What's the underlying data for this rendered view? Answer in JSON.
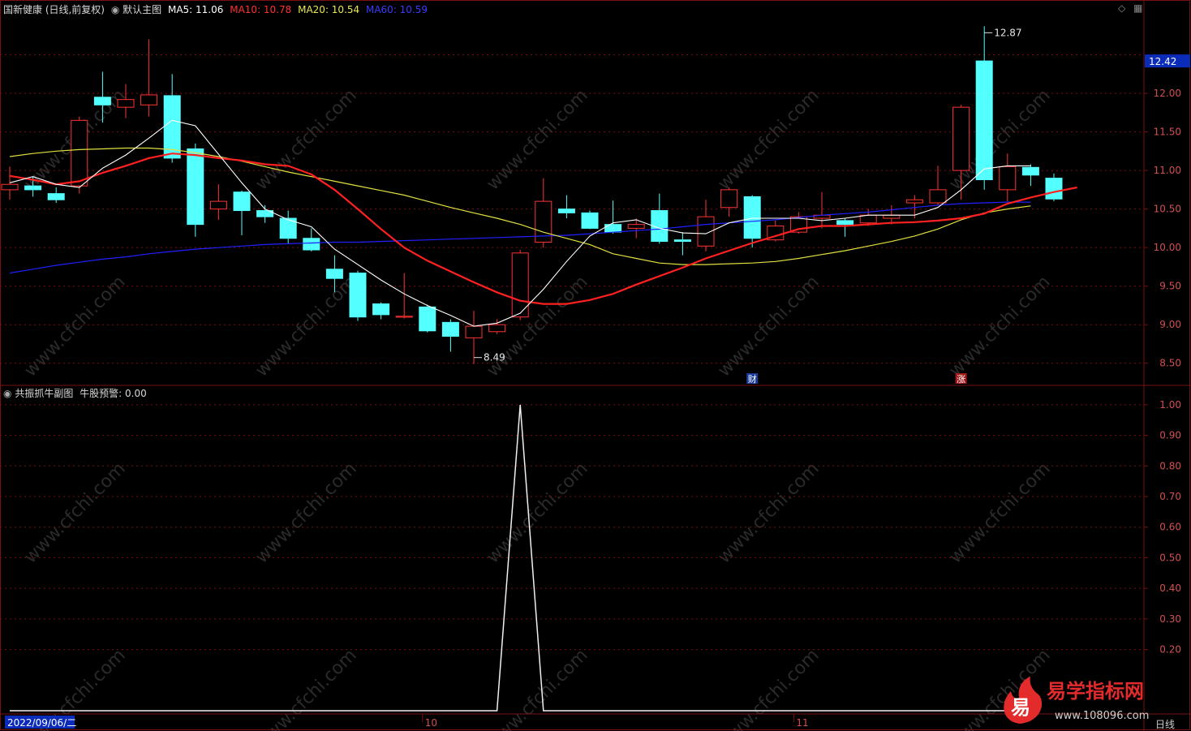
{
  "header": {
    "stock_label": "国新健康 (日线,前复权)",
    "template_label": "默认主图",
    "ma5_label": "MA5: 11.06",
    "ma10_label": "MA10: 10.78",
    "ma20_label": "MA20: 10.54",
    "ma60_label": "MA60: 10.59"
  },
  "sub_header": {
    "indicator_label": "共振抓牛副图",
    "alert_label": "牛股预警: 0.00"
  },
  "footer": {
    "cursor_date": "2022/09/06/二",
    "month_labels": [
      "10",
      "11"
    ],
    "period_label": "日线"
  },
  "markers": {
    "finance": "财",
    "limit_up": "涨"
  },
  "watermark": "www.cfchi.com",
  "logo": {
    "glyph": "易",
    "name": "易学指标网",
    "url": "www.108096.com"
  },
  "colors": {
    "background": "#000000",
    "up": "#ff3232",
    "down": "#54ffff",
    "ma5": "#ffffff",
    "ma10": "#ff2020",
    "ma20": "#e0e040",
    "ma60": "#2020ff",
    "grid": "#7a1010",
    "axis_text": "#d05050"
  },
  "chart_data": [
    {
      "type": "candlestick",
      "title": "国新健康 (日线,前复权)",
      "x": [
        "1",
        "2",
        "3",
        "4",
        "5",
        "6",
        "7",
        "8",
        "9",
        "10",
        "11",
        "12",
        "13",
        "14",
        "15",
        "16",
        "17",
        "18",
        "19",
        "20",
        "21",
        "22",
        "23",
        "24",
        "25",
        "26",
        "27",
        "28",
        "29",
        "30",
        "31",
        "32",
        "33",
        "34",
        "35",
        "36",
        "37",
        "38",
        "39",
        "40",
        "41",
        "42",
        "43",
        "44",
        "45"
      ],
      "candles": [
        {
          "o": 10.75,
          "c": 10.82,
          "h": 11.05,
          "l": 10.62
        },
        {
          "o": 10.8,
          "c": 10.75,
          "h": 10.92,
          "l": 10.66
        },
        {
          "o": 10.7,
          "c": 10.62,
          "h": 10.78,
          "l": 10.58
        },
        {
          "o": 10.8,
          "c": 11.65,
          "h": 11.7,
          "l": 10.7
        },
        {
          "o": 11.95,
          "c": 11.85,
          "h": 12.28,
          "l": 11.62
        },
        {
          "o": 11.82,
          "c": 11.92,
          "h": 12.12,
          "l": 11.68
        },
        {
          "o": 11.85,
          "c": 11.98,
          "h": 12.7,
          "l": 11.7
        },
        {
          "o": 11.97,
          "c": 11.16,
          "h": 12.25,
          "l": 11.1
        },
        {
          "o": 11.28,
          "c": 10.3,
          "h": 11.35,
          "l": 10.14
        },
        {
          "o": 10.5,
          "c": 10.6,
          "h": 10.82,
          "l": 10.36
        },
        {
          "o": 10.72,
          "c": 10.48,
          "h": 10.74,
          "l": 10.16
        },
        {
          "o": 10.48,
          "c": 10.4,
          "h": 10.55,
          "l": 10.32
        },
        {
          "o": 10.38,
          "c": 10.12,
          "h": 10.48,
          "l": 10.05
        },
        {
          "o": 10.12,
          "c": 9.97,
          "h": 10.25,
          "l": 9.95
        },
        {
          "o": 9.72,
          "c": 9.6,
          "h": 9.9,
          "l": 9.42
        },
        {
          "o": 9.67,
          "c": 9.1,
          "h": 9.7,
          "l": 9.05
        },
        {
          "o": 9.27,
          "c": 9.13,
          "h": 9.29,
          "l": 9.07
        },
        {
          "o": 9.1,
          "c": 9.11,
          "h": 9.67,
          "l": 9.08
        },
        {
          "o": 9.23,
          "c": 8.92,
          "h": 9.26,
          "l": 8.9
        },
        {
          "o": 9.03,
          "c": 8.85,
          "h": 9.07,
          "l": 8.65
        },
        {
          "o": 8.83,
          "c": 8.98,
          "h": 9.18,
          "l": 8.49
        },
        {
          "o": 8.91,
          "c": 9.0,
          "h": 9.07,
          "l": 8.88
        },
        {
          "o": 9.1,
          "c": 9.93,
          "h": 9.97,
          "l": 9.06
        },
        {
          "o": 10.07,
          "c": 10.6,
          "h": 10.9,
          "l": 10.0
        },
        {
          "o": 10.5,
          "c": 10.45,
          "h": 10.68,
          "l": 10.38
        },
        {
          "o": 10.45,
          "c": 10.25,
          "h": 10.48,
          "l": 10.24
        },
        {
          "o": 10.3,
          "c": 10.2,
          "h": 10.61,
          "l": 10.18
        },
        {
          "o": 10.25,
          "c": 10.3,
          "h": 10.38,
          "l": 10.12
        },
        {
          "o": 10.48,
          "c": 10.08,
          "h": 10.7,
          "l": 10.05
        },
        {
          "o": 10.1,
          "c": 10.08,
          "h": 10.2,
          "l": 9.9
        },
        {
          "o": 10.02,
          "c": 10.4,
          "h": 10.62,
          "l": 9.95
        },
        {
          "o": 10.52,
          "c": 10.75,
          "h": 10.78,
          "l": 10.4
        },
        {
          "o": 10.66,
          "c": 10.12,
          "h": 10.68,
          "l": 10.0
        },
        {
          "o": 10.1,
          "c": 10.28,
          "h": 10.35,
          "l": 10.08
        },
        {
          "o": 10.2,
          "c": 10.4,
          "h": 10.46,
          "l": 10.18
        },
        {
          "o": 10.38,
          "c": 10.42,
          "h": 10.72,
          "l": 10.25
        },
        {
          "o": 10.35,
          "c": 10.3,
          "h": 10.38,
          "l": 10.14
        },
        {
          "o": 10.32,
          "c": 10.42,
          "h": 10.5,
          "l": 10.28
        },
        {
          "o": 10.38,
          "c": 10.42,
          "h": 10.55,
          "l": 10.3
        },
        {
          "o": 10.58,
          "c": 10.62,
          "h": 10.68,
          "l": 10.38
        },
        {
          "o": 10.58,
          "c": 10.75,
          "h": 11.06,
          "l": 10.55
        },
        {
          "o": 11.0,
          "c": 11.82,
          "h": 11.85,
          "l": 10.62
        },
        {
          "o": 12.42,
          "c": 10.88,
          "h": 12.87,
          "l": 10.75
        },
        {
          "o": 10.75,
          "c": 11.05,
          "h": 11.22,
          "l": 10.6
        },
        {
          "o": 11.04,
          "c": 10.94,
          "h": 11.08,
          "l": 10.8
        },
        {
          "o": 10.9,
          "c": 10.63,
          "h": 10.96,
          "l": 10.6
        }
      ],
      "ma5": [
        10.84,
        10.92,
        10.82,
        10.78,
        11.03,
        11.2,
        11.42,
        11.65,
        11.58,
        11.21,
        10.84,
        10.5,
        10.36,
        10.27,
        9.98,
        9.78,
        9.58,
        9.4,
        9.25,
        9.12,
        8.98,
        9.02,
        9.15,
        9.46,
        9.82,
        10.15,
        10.32,
        10.36,
        10.25,
        10.19,
        10.18,
        10.32,
        10.38,
        10.38,
        10.38,
        10.35,
        10.38,
        10.42,
        10.42,
        10.42,
        10.52,
        10.75,
        11.02,
        11.06,
        11.06
      ],
      "ma10": [
        10.93,
        10.88,
        10.82,
        10.86,
        10.97,
        11.06,
        11.16,
        11.22,
        11.2,
        11.16,
        11.13,
        11.08,
        11.06,
        10.95,
        10.75,
        10.5,
        10.24,
        10.0,
        9.83,
        9.69,
        9.55,
        9.42,
        9.31,
        9.27,
        9.27,
        9.32,
        9.4,
        9.52,
        9.63,
        9.74,
        9.86,
        9.96,
        10.06,
        10.15,
        10.24,
        10.28,
        10.28,
        10.3,
        10.32,
        10.33,
        10.35,
        10.38,
        10.44,
        10.57,
        10.65,
        10.72,
        10.78
      ],
      "ma20": [
        11.18,
        11.22,
        11.25,
        11.27,
        11.28,
        11.29,
        11.29,
        11.27,
        11.23,
        11.18,
        11.12,
        11.05,
        10.98,
        10.92,
        10.86,
        10.8,
        10.74,
        10.68,
        10.6,
        10.52,
        10.45,
        10.38,
        10.3,
        10.2,
        10.12,
        10.04,
        9.92,
        9.86,
        9.8,
        9.78,
        9.78,
        9.79,
        9.8,
        9.82,
        9.86,
        9.91,
        9.96,
        10.02,
        10.08,
        10.15,
        10.24,
        10.36,
        10.45,
        10.5,
        10.54
      ],
      "ma60": [
        9.67,
        9.72,
        9.77,
        9.81,
        9.85,
        9.88,
        9.92,
        9.95,
        9.98,
        10.0,
        10.02,
        10.04,
        10.05,
        10.06,
        10.07,
        10.07,
        10.08,
        10.09,
        10.1,
        10.11,
        10.12,
        10.13,
        10.14,
        10.15,
        10.16,
        10.18,
        10.2,
        10.22,
        10.24,
        10.27,
        10.3,
        10.32,
        10.34,
        10.36,
        10.39,
        10.42,
        10.44,
        10.46,
        10.49,
        10.52,
        10.55,
        10.57,
        10.58,
        10.59,
        10.59
      ],
      "yticks": [
        8.5,
        9.0,
        9.5,
        10.0,
        10.5,
        11.0,
        11.5,
        12.0
      ],
      "ylim": [
        8.35,
        13.0
      ],
      "annotations": [
        {
          "label": "8.49",
          "value": 8.49
        },
        {
          "label": "12.87",
          "value": 12.87
        }
      ],
      "last_price_label": "12.42"
    },
    {
      "type": "line",
      "title": "共振抓牛副图",
      "series": [
        {
          "name": "牛股预警",
          "values": [
            0,
            0,
            0,
            0,
            0,
            0,
            0,
            0,
            0,
            0,
            0,
            0,
            0,
            0,
            0,
            0,
            0,
            0,
            0,
            0,
            0,
            0,
            1,
            0,
            0,
            0,
            0,
            0,
            0,
            0,
            0,
            0,
            0,
            0,
            0,
            0,
            0,
            0,
            0,
            0,
            0,
            0,
            0,
            0,
            0
          ]
        }
      ],
      "yticks": [
        0.2,
        0.3,
        0.4,
        0.5,
        0.6,
        0.7,
        0.8,
        0.9,
        1.0
      ],
      "ylim": [
        0,
        1.05
      ]
    }
  ]
}
